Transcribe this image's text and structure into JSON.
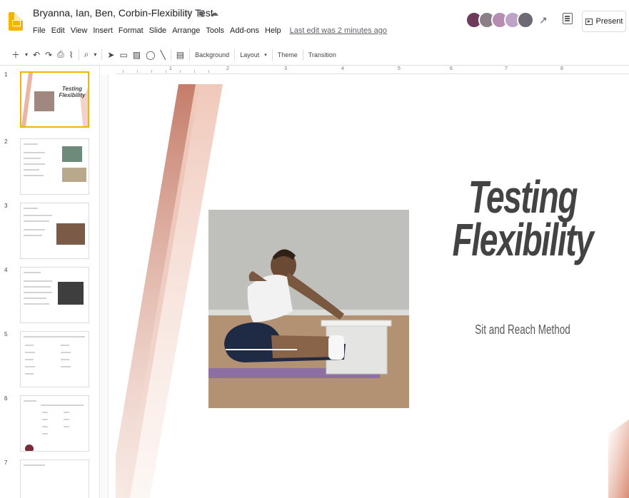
{
  "header": {
    "doc_title": "Bryanna, Ian, Ben, Corbin-Flexibility Test",
    "menu": [
      "File",
      "Edit",
      "View",
      "Insert",
      "Format",
      "Slide",
      "Arrange",
      "Tools",
      "Add-ons",
      "Help"
    ],
    "last_edit": "Last edit was 2 minutes ago",
    "present_label": "Present",
    "avatar_colors": [
      "#6d3a5a",
      "#8a7f86",
      "#b58cb2",
      "#bfa2c7",
      "#6e6a75"
    ]
  },
  "toolbar": {
    "background_label": "Background",
    "layout_label": "Layout",
    "theme_label": "Theme",
    "transition_label": "Transition"
  },
  "ruler": {
    "numbers": [
      "1",
      "2",
      "3",
      "4",
      "5",
      "6",
      "7",
      "8"
    ]
  },
  "filmstrip": {
    "slide_numbers": [
      "1",
      "2",
      "3",
      "4",
      "5",
      "6",
      "7"
    ],
    "selected": "1",
    "thumb1_title": "Testing Flexibility"
  },
  "slide": {
    "title_line1": "Testing",
    "title_line2": "Flexibility",
    "subtitle": "Sit and Reach Method"
  },
  "colors": {
    "accent_brand": "#f4b400",
    "slide_stripe_dark": "#c9826d",
    "slide_stripe_light": "#f1d2c6"
  }
}
